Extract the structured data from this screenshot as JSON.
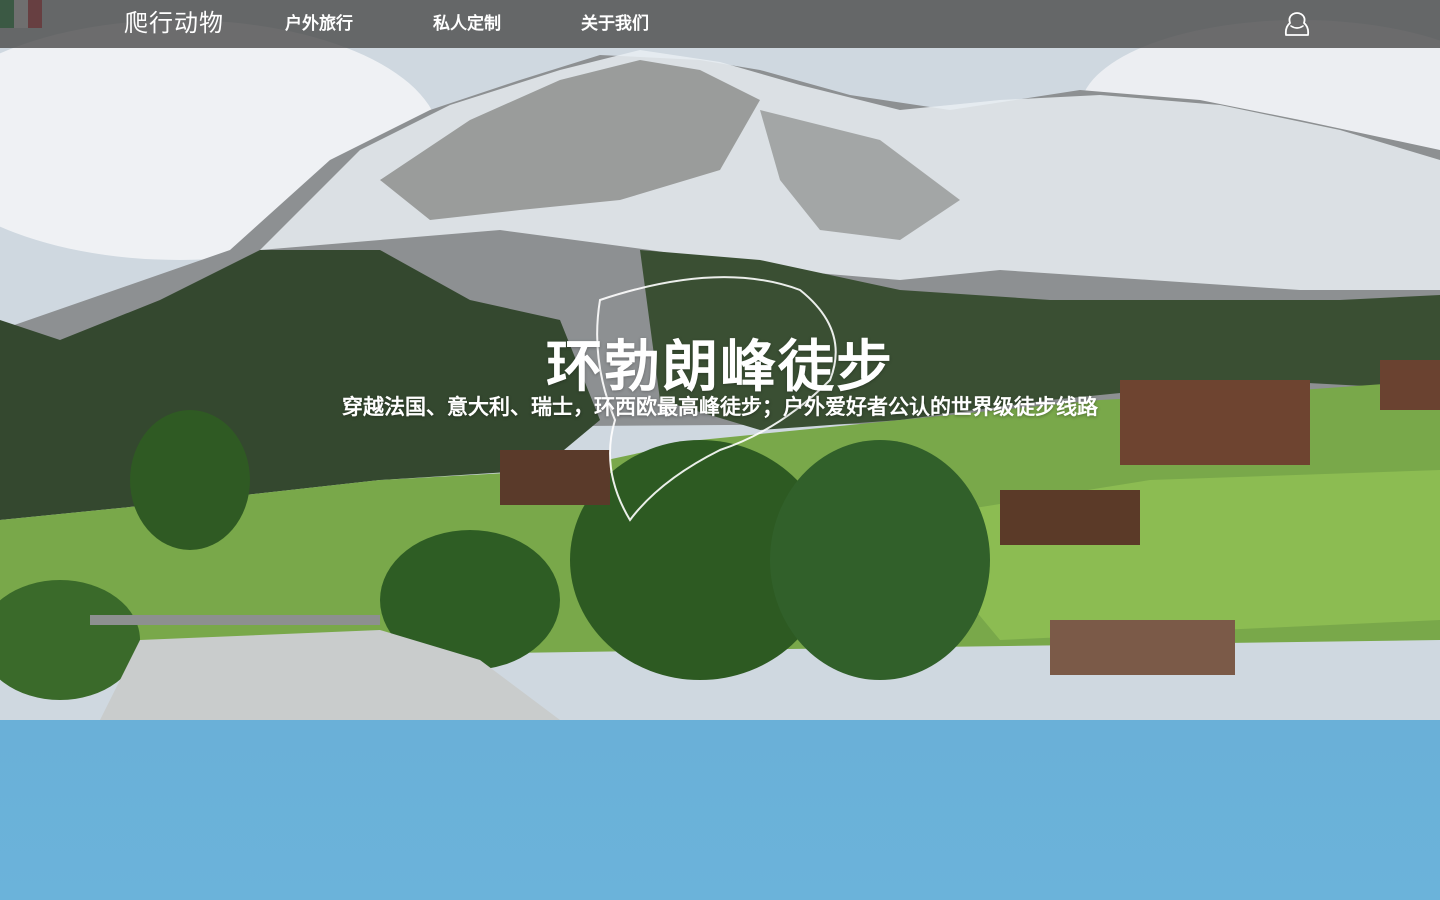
{
  "nav": {
    "logo": "爬行动物",
    "items": [
      "户外旅行",
      "私人定制",
      "关于我们"
    ]
  },
  "hero": {
    "title": "环勃朗峰徒步",
    "subtitle": "穿越法国、意大利、瑞士，环西欧最高峰徒步；户外爱好者公认的世界级徒步线路"
  },
  "icons": {
    "user": "user-icon",
    "flags": [
      "switzerland-flag",
      "france-flag",
      "italy-flag"
    ]
  },
  "colors": {
    "navbar": "#464646",
    "sky_section": "#6ab0d8",
    "text": "#ffffff"
  }
}
